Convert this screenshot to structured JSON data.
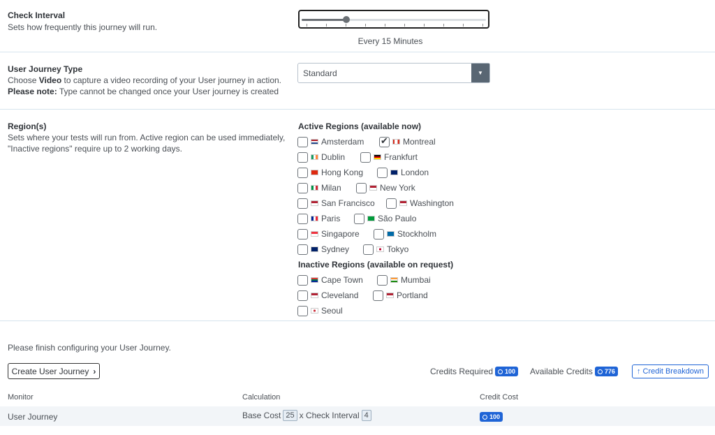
{
  "check_interval": {
    "title": "Check Interval",
    "desc": "Sets how frequently this journey will run.",
    "value_label": "Every 15 Minutes",
    "level": 0.23
  },
  "journey_type": {
    "title": "User Journey Type",
    "desc_pre": "Choose ",
    "desc_bold": "Video",
    "desc_post": " to capture a video recording of your User journey in action.",
    "note_bold": "Please note:",
    "note_text": " Type cannot be changed once your User journey is created",
    "selected": "Standard"
  },
  "regions": {
    "title": "Region(s)",
    "desc1": "Sets where your tests will run from. Active region can be used immediately,",
    "desc2": "\"Inactive regions\" require up to 2 working days.",
    "active_header": "Active Regions (available now)",
    "inactive_header": "Inactive Regions (available on request)",
    "active": [
      {
        "label": "Amsterdam",
        "checked": false
      },
      {
        "label": "Montreal",
        "checked": true
      },
      {
        "label": "Dublin",
        "checked": false
      },
      {
        "label": "Frankfurt",
        "checked": false
      },
      {
        "label": "Hong Kong",
        "checked": false
      },
      {
        "label": "London",
        "checked": false
      },
      {
        "label": "Milan",
        "checked": false
      },
      {
        "label": "New York",
        "checked": false
      },
      {
        "label": "San Francisco",
        "checked": false
      },
      {
        "label": "Washington",
        "checked": false
      },
      {
        "label": "Paris",
        "checked": false
      },
      {
        "label": "São Paulo",
        "checked": false
      },
      {
        "label": "Singapore",
        "checked": false
      },
      {
        "label": "Stockholm",
        "checked": false
      },
      {
        "label": "Sydney",
        "checked": false
      },
      {
        "label": "Tokyo",
        "checked": false
      }
    ],
    "inactive": [
      {
        "label": "Cape Town",
        "checked": false
      },
      {
        "label": "Mumbai",
        "checked": false
      },
      {
        "label": "Cleveland",
        "checked": false
      },
      {
        "label": "Portland",
        "checked": false
      },
      {
        "label": "Seoul",
        "checked": false
      }
    ]
  },
  "footer": {
    "finish_msg": "Please finish configuring your User Journey.",
    "create_label": "Create User Journey",
    "credits_required_label": "Credits Required",
    "credits_required_value": "100",
    "available_credits_label": "Available Credits",
    "available_credits_value": "776",
    "breakdown_label": "↑ Credit Breakdown"
  },
  "table": {
    "headers": [
      "Monitor",
      "Calculation",
      "Credit Cost"
    ],
    "row": {
      "monitor": "User Journey",
      "base_cost_label": "Base Cost",
      "base_cost_value": "25",
      "times_label": "x Check Interval",
      "interval_value": "4",
      "credit_cost": "100"
    }
  },
  "colors": {
    "accent": "#1f64d6",
    "divider": "#d6e4ee",
    "select_arrow_bg": "#596673"
  }
}
